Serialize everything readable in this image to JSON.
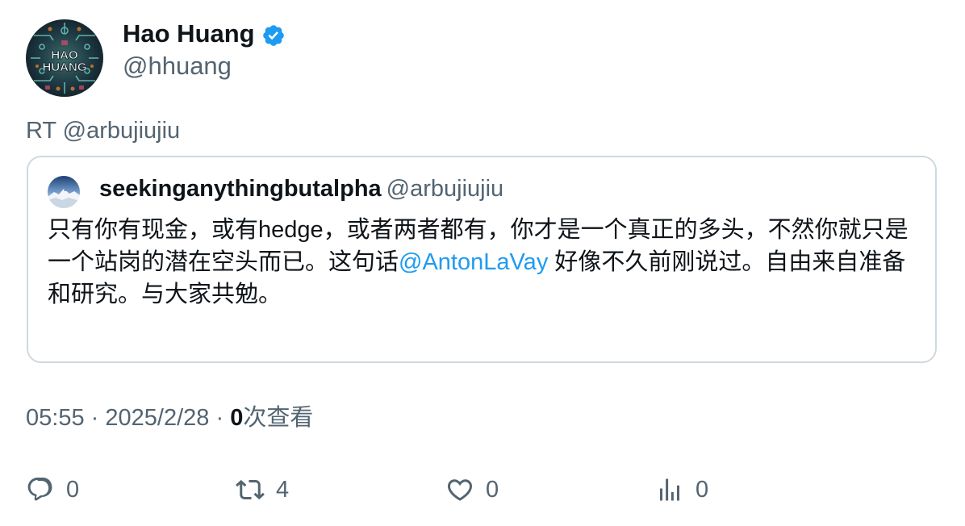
{
  "tweet": {
    "author": {
      "name": "Hao Huang",
      "handle": "@hhuang",
      "avatar_text_line1": "HAO",
      "avatar_text_line2": "HUANG",
      "verified": true,
      "verified_color": "#1d9bf0"
    },
    "retweet_prefix": "RT @arbujiujiu",
    "quote": {
      "name": "seekinganythingbutalpha",
      "handle": "@arbujiujiu",
      "text_before": "只有你有现金，或有hedge，或者两者都有，你才是一个真正的多头，不然你就只是一个站岗的潜在空头而已。这句话",
      "mention": "@AntonLaVay",
      "text_after": " 好像不久前刚说过。自由来自准备和研究。与大家共勉。"
    },
    "meta": {
      "time": "05:55",
      "date": "2025/2/28",
      "views_count": "0",
      "views_label": "次查看"
    },
    "actions": {
      "reply": {
        "icon": "reply-icon",
        "count": "0"
      },
      "retweet": {
        "icon": "retweet-icon",
        "count": "4"
      },
      "like": {
        "icon": "heart-icon",
        "count": "0"
      },
      "views": {
        "icon": "analytics-icon",
        "count": "0"
      }
    }
  },
  "colors": {
    "primary_text": "#0f1419",
    "secondary_text": "#536471",
    "link": "#1d9bf0",
    "border": "#cfd9de"
  }
}
